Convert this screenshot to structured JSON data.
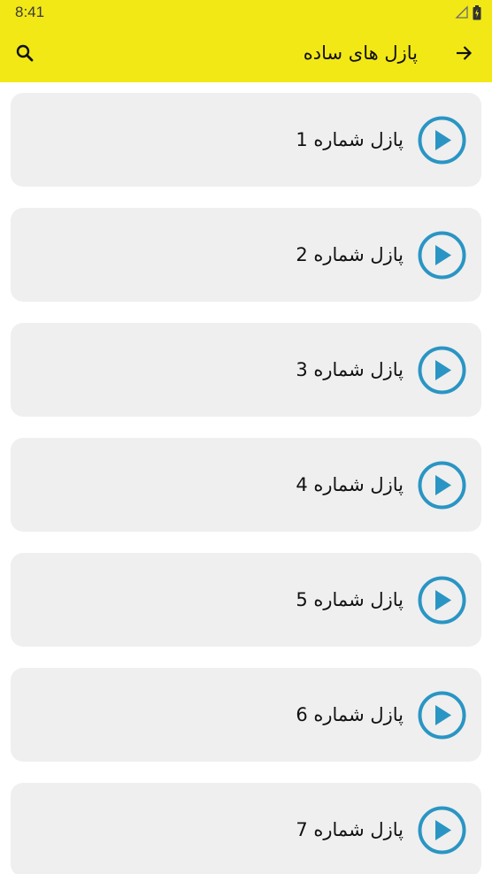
{
  "status_bar": {
    "time": "8:41"
  },
  "header": {
    "title": "پازل های ساده",
    "search_icon": "search-icon",
    "back_icon": "arrow-right-icon",
    "background": "#f2e816"
  },
  "items": [
    {
      "label": "پازل شماره 1",
      "icon": "play-circle-icon"
    },
    {
      "label": "پازل شماره 2",
      "icon": "play-circle-icon"
    },
    {
      "label": "پازل شماره 3",
      "icon": "play-circle-icon"
    },
    {
      "label": "پازل شماره 4",
      "icon": "play-circle-icon"
    },
    {
      "label": "پازل شماره 5",
      "icon": "play-circle-icon"
    },
    {
      "label": "پازل شماره 6",
      "icon": "play-circle-icon"
    },
    {
      "label": "پازل شماره 7",
      "icon": "play-circle-icon"
    }
  ],
  "colors": {
    "accent": "#2a95c4",
    "card": "#efefef"
  }
}
